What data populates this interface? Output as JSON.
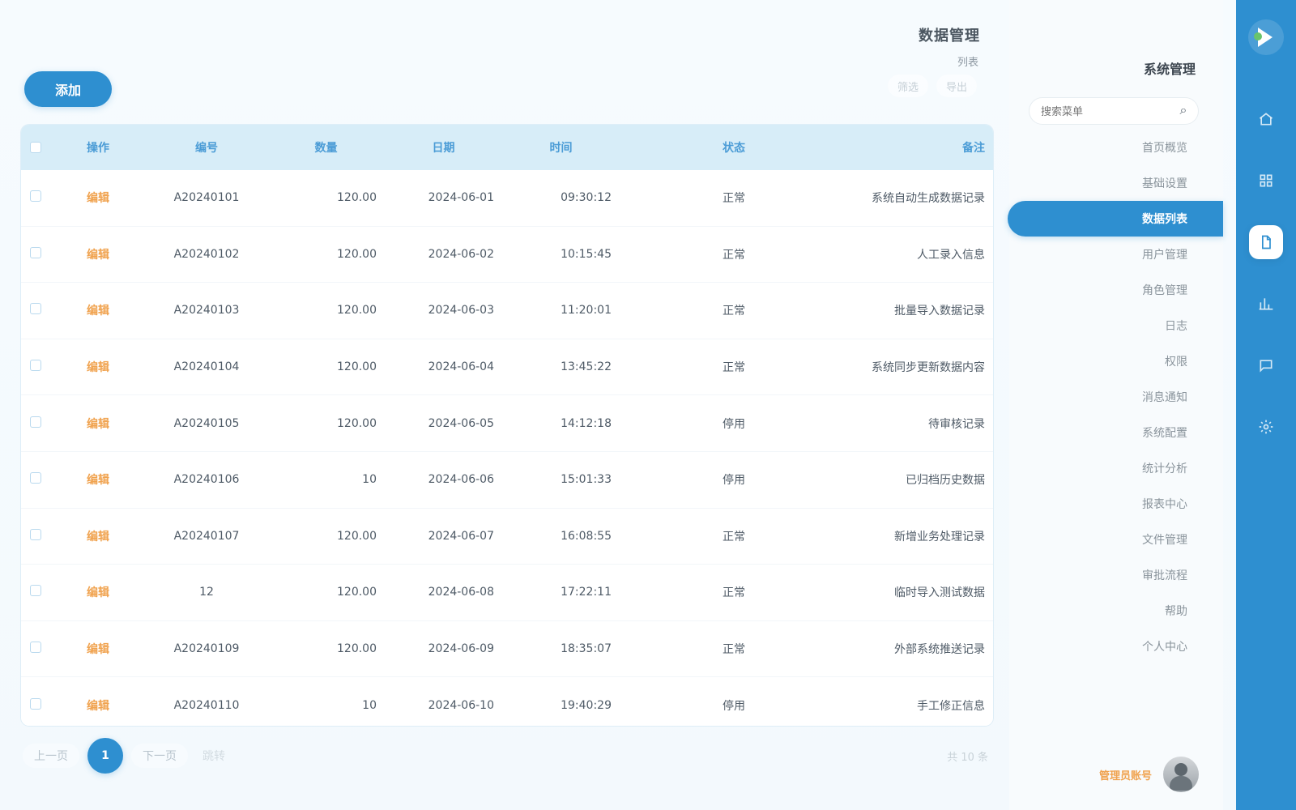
{
  "colors": {
    "primary": "#2e8fd0",
    "header_bg": "#d7edf8",
    "accent_orange": "#f0a24e",
    "text_main": "#4e5a66",
    "text_muted": "#8a949c"
  },
  "topbar": {
    "add_button_label": "添加",
    "add_hint": "",
    "title": "数据管理",
    "subtitle": "列表",
    "tools": [
      "筛选",
      "导出"
    ]
  },
  "table": {
    "columns": [
      "",
      "操作",
      "编号",
      "数量",
      "日期",
      "时间",
      "状态",
      "备注"
    ],
    "rows": [
      {
        "action": "编辑",
        "code": "A20240101",
        "qty": "120.00",
        "date": "2024-06-01",
        "time": "09:30:12",
        "status": "正常",
        "remark": "系统自动生成数据记录"
      },
      {
        "action": "编辑",
        "code": "A20240102",
        "qty": "120.00",
        "date": "2024-06-02",
        "time": "10:15:45",
        "status": "正常",
        "remark": "人工录入信息"
      },
      {
        "action": "编辑",
        "code": "A20240103",
        "qty": "120.00",
        "date": "2024-06-03",
        "time": "11:20:01",
        "status": "正常",
        "remark": "批量导入数据记录"
      },
      {
        "action": "编辑",
        "code": "A20240104",
        "qty": "120.00",
        "date": "2024-06-04",
        "time": "13:45:22",
        "status": "正常",
        "remark": "系统同步更新数据内容"
      },
      {
        "action": "编辑",
        "code": "A20240105",
        "qty": "120.00",
        "date": "2024-06-05",
        "time": "14:12:18",
        "status": "停用",
        "remark": "待审核记录"
      },
      {
        "action": "编辑",
        "code": "A20240106",
        "qty": "10",
        "date": "2024-06-06",
        "time": "15:01:33",
        "status": "停用",
        "remark": "已归档历史数据"
      },
      {
        "action": "编辑",
        "code": "A20240107",
        "qty": "120.00",
        "date": "2024-06-07",
        "time": "16:08:55",
        "status": "正常",
        "remark": "新增业务处理记录"
      },
      {
        "action": "编辑",
        "code": "12",
        "qty": "120.00",
        "date": "2024-06-08",
        "time": "17:22:11",
        "status": "正常",
        "remark": "临时导入测试数据"
      },
      {
        "action": "编辑",
        "code": "A20240109",
        "qty": "120.00",
        "date": "2024-06-09",
        "time": "18:35:07",
        "status": "正常",
        "remark": "外部系统推送记录"
      },
      {
        "action": "编辑",
        "code": "A20240110",
        "qty": "10",
        "date": "2024-06-10",
        "time": "19:40:29",
        "status": "停用",
        "remark": "手工修正信息"
      }
    ]
  },
  "pagination": {
    "prev": "上一页",
    "current": "1",
    "next": "下一页",
    "jump": "跳转",
    "status": "共 10 条"
  },
  "side_menu": {
    "title": "系统管理",
    "search_placeholder": "搜索菜单",
    "items": [
      "首页概览",
      "基础设置",
      "数据列表",
      "用户管理",
      "角色管理",
      "日志",
      "权限",
      "消息通知",
      "系统配置",
      "统计分析",
      "报表中心",
      "文件管理",
      "审批流程",
      "帮助",
      "个人中心"
    ],
    "active_index": 2,
    "user_name": "管理员账号"
  },
  "icon_rail": {
    "items": [
      "home-icon",
      "grid-icon",
      "document-icon",
      "chart-icon",
      "message-icon",
      "settings-icon"
    ],
    "active_index": 2
  }
}
